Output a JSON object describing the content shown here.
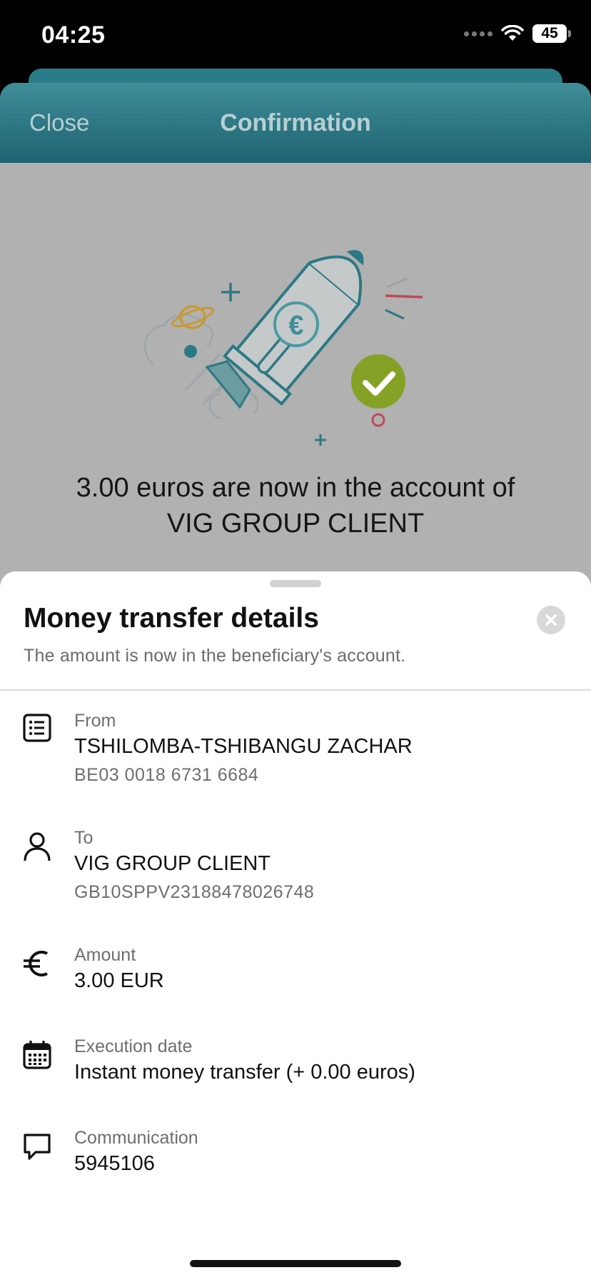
{
  "status_bar": {
    "time": "04:25",
    "battery": "45"
  },
  "header": {
    "close_label": "Close",
    "title": "Confirmation"
  },
  "confirmation": {
    "line1": "3.00 euros are now in the account of",
    "line2": "VIG GROUP CLIENT"
  },
  "sheet": {
    "title": "Money transfer details",
    "subtitle": "The amount is now in the beneficiary's account.",
    "rows": {
      "from": {
        "label": "From",
        "value": "TSHILOMBA-TSHIBANGU ZACHAR",
        "sub": "BE03 0018 6731 6684",
        "icon": "list-icon"
      },
      "to": {
        "label": "To",
        "value": "VIG GROUP CLIENT",
        "sub": "GB10SPPV23188478026748",
        "icon": "person-icon"
      },
      "amount": {
        "label": "Amount",
        "value": "3.00 EUR",
        "icon": "euro-icon"
      },
      "execution_date": {
        "label": "Execution date",
        "value": "Instant money transfer (+ 0.00 euros)",
        "icon": "calendar-icon"
      },
      "communication": {
        "label": "Communication",
        "value": "5945106",
        "icon": "chat-bubble-icon"
      }
    }
  },
  "colors": {
    "header_teal": "#2f7a86",
    "success_green": "#8aa827",
    "dim_overlay": "#b1b1b1"
  }
}
